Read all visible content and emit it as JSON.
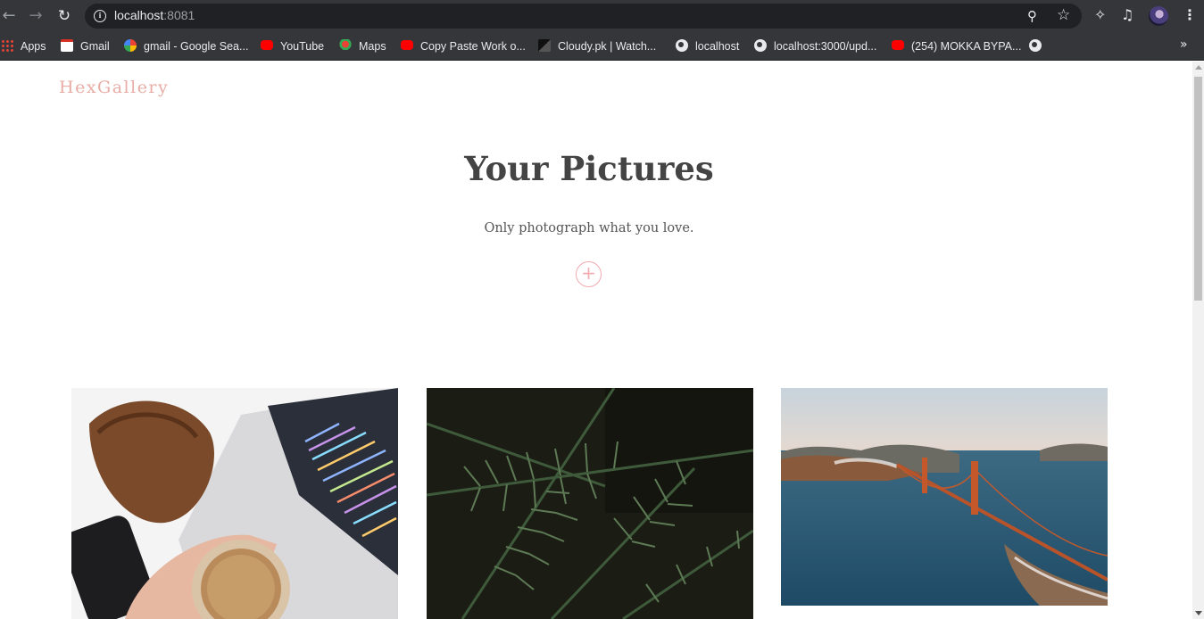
{
  "browser": {
    "url_host": "localhost",
    "url_port": ":8081",
    "nav_icons": [
      "back-arrow-icon",
      "forward-arrow-icon",
      "reload-icon"
    ],
    "toolbar_icons": [
      "zoom-icon",
      "star-icon",
      "extensions-icon",
      "media-queue-icon",
      "profile-avatar",
      "menu-kebab-icon"
    ]
  },
  "bookmarks": [
    {
      "label": "Apps",
      "icon": "apps-grid-icon"
    },
    {
      "label": "Gmail",
      "icon": "gmail-icon"
    },
    {
      "label": "gmail - Google Sea...",
      "icon": "google-icon"
    },
    {
      "label": "YouTube",
      "icon": "youtube-icon"
    },
    {
      "label": "Maps",
      "icon": "maps-icon"
    },
    {
      "label": "Copy Paste Work o...",
      "icon": "youtube-icon"
    },
    {
      "label": "Cloudy.pk | Watch...",
      "icon": "cloudy-icon"
    },
    {
      "label": "localhost",
      "icon": "globe-icon"
    },
    {
      "label": "localhost:3000/upd...",
      "icon": "globe-icon"
    },
    {
      "label": "(254) MOKKA BYPA...",
      "icon": "youtube-icon"
    },
    {
      "label": "",
      "icon": "globe-icon"
    }
  ],
  "site": {
    "brand": "HexGallery",
    "title": "Your Pictures",
    "subtitle": "Only photograph what you love.",
    "add_symbol": "+",
    "accent_color": "#e8aca5"
  },
  "gallery": [
    {
      "subject": "laptop with code, coffee and sunglasses case",
      "icon": "photo-image"
    },
    {
      "subject": "pine tree branches",
      "icon": "photo-image"
    },
    {
      "subject": "aerial view of Golden Gate Bridge",
      "icon": "photo-image"
    }
  ]
}
